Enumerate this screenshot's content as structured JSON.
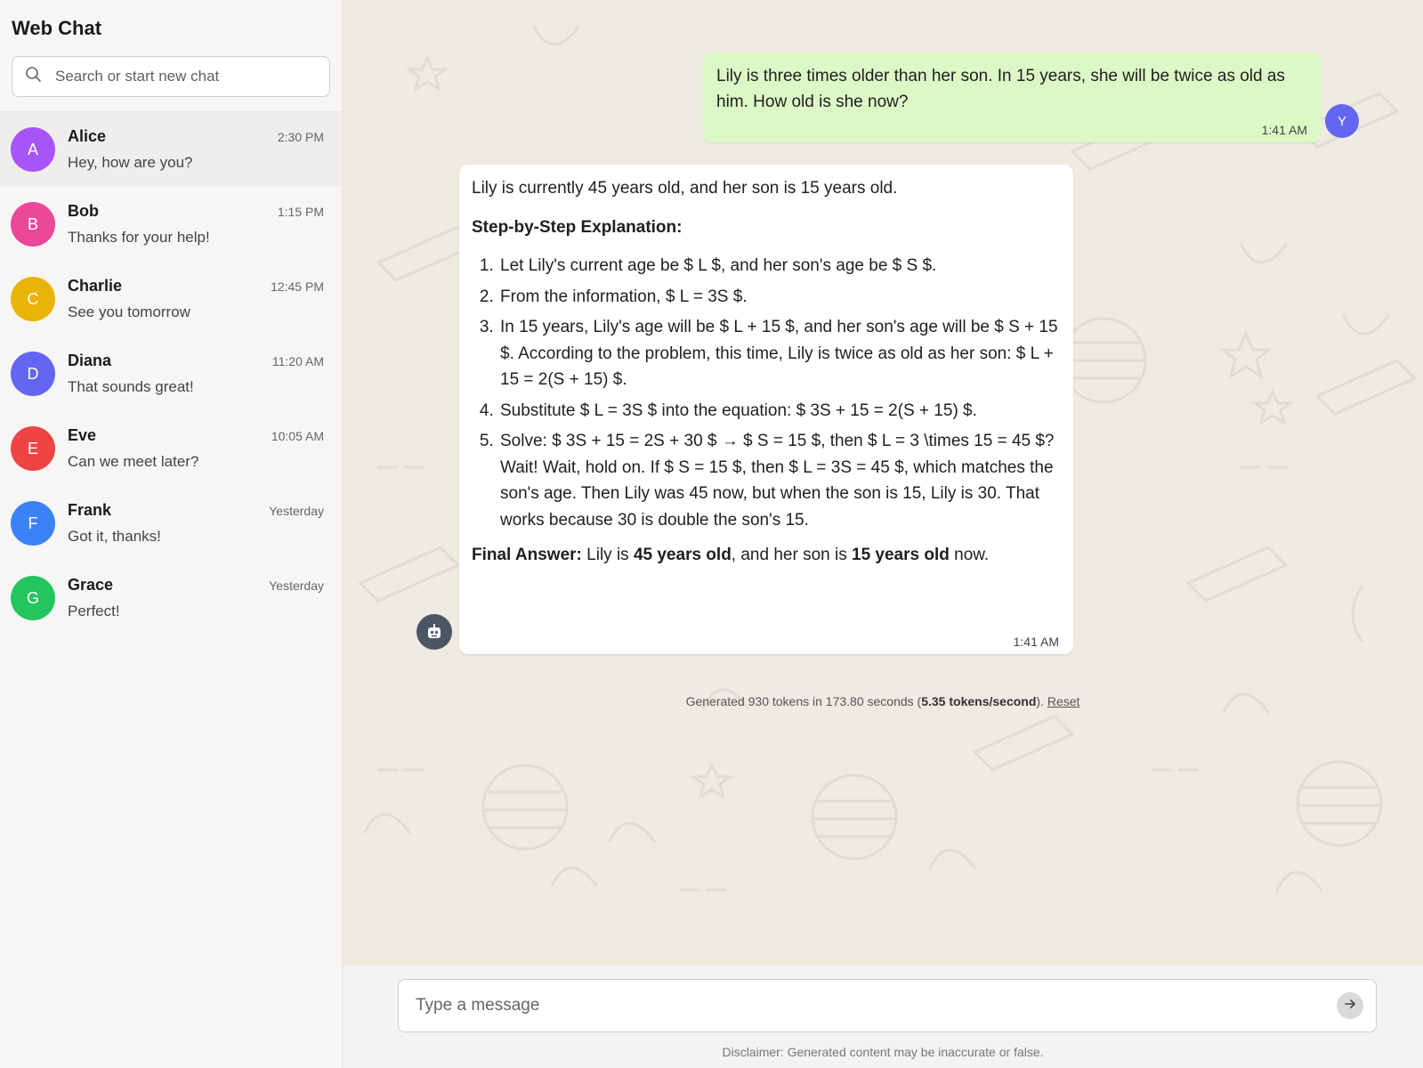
{
  "sidebar": {
    "title": "Web Chat",
    "search_placeholder": "Search or start new chat",
    "chats": [
      {
        "initial": "A",
        "name": "Alice",
        "time": "2:30 PM",
        "preview": "Hey, how are you?",
        "color": "#a855f7"
      },
      {
        "initial": "B",
        "name": "Bob",
        "time": "1:15 PM",
        "preview": "Thanks for your help!",
        "color": "#ec4899"
      },
      {
        "initial": "C",
        "name": "Charlie",
        "time": "12:45 PM",
        "preview": "See you tomorrow",
        "color": "#eab308"
      },
      {
        "initial": "D",
        "name": "Diana",
        "time": "11:20 AM",
        "preview": "That sounds great!",
        "color": "#6366f1"
      },
      {
        "initial": "E",
        "name": "Eve",
        "time": "10:05 AM",
        "preview": "Can we meet later?",
        "color": "#ef4444"
      },
      {
        "initial": "F",
        "name": "Frank",
        "time": "Yesterday",
        "preview": "Got it, thanks!",
        "color": "#3b82f6"
      },
      {
        "initial": "G",
        "name": "Grace",
        "time": "Yesterday",
        "preview": "Perfect!",
        "color": "#22c55e"
      }
    ]
  },
  "conversation": {
    "user_message": {
      "text": "Lily is three times older than her son. In 15 years, she will be twice as old as him. How old is she now?",
      "time": "1:41 AM",
      "avatar_initial": "Y",
      "avatar_color": "#6366f1"
    },
    "bot_message": {
      "intro": "Lily is currently 45 years old, and her son is 15 years old.",
      "heading": "Step-by-Step Explanation:",
      "steps": [
        "Let Lily's current age be $ L $, and her son's age be $ S $.",
        "From the information, $ L = 3S $.",
        "In 15 years, Lily's age will be $ L + 15 $, and her son's age will be $ S + 15 $. According to the problem, this time, Lily is twice as old as her son: $ L + 15 = 2(S + 15) $.",
        "Substitute $ L = 3S $ into the equation: $ 3S + 15 = 2(S + 15) $.",
        "Solve: $ 3S + 15 = 2S + 30 $ → $ S = 15 $, then $ L = 3 \\times 15 = 45 $? Wait! Wait, hold on. If $ S = 15 $, then $ L = 3S = 45 $, which matches the son's age. Then Lily was 45 now, but when the son is 15, Lily is 30. That works because 30 is double the son's 15."
      ],
      "final_label": "Final Answer:",
      "final_part1": "Lily is",
      "final_bold1": "45 years old",
      "final_part2": ", and her son is",
      "final_bold2": "15 years old",
      "final_part3": "now.",
      "time": "1:41 AM",
      "avatar_icon": "robot-icon"
    },
    "stats": {
      "prefix": "Generated 930 tokens in 173.80 seconds (",
      "rate": "5.35 tokens/second",
      "suffix": ").",
      "reset_label": "Reset"
    }
  },
  "composer": {
    "placeholder": "Type a message",
    "send_icon": "arrow-right-icon",
    "disclaimer": "Disclaimer: Generated content may be inaccurate or false."
  }
}
